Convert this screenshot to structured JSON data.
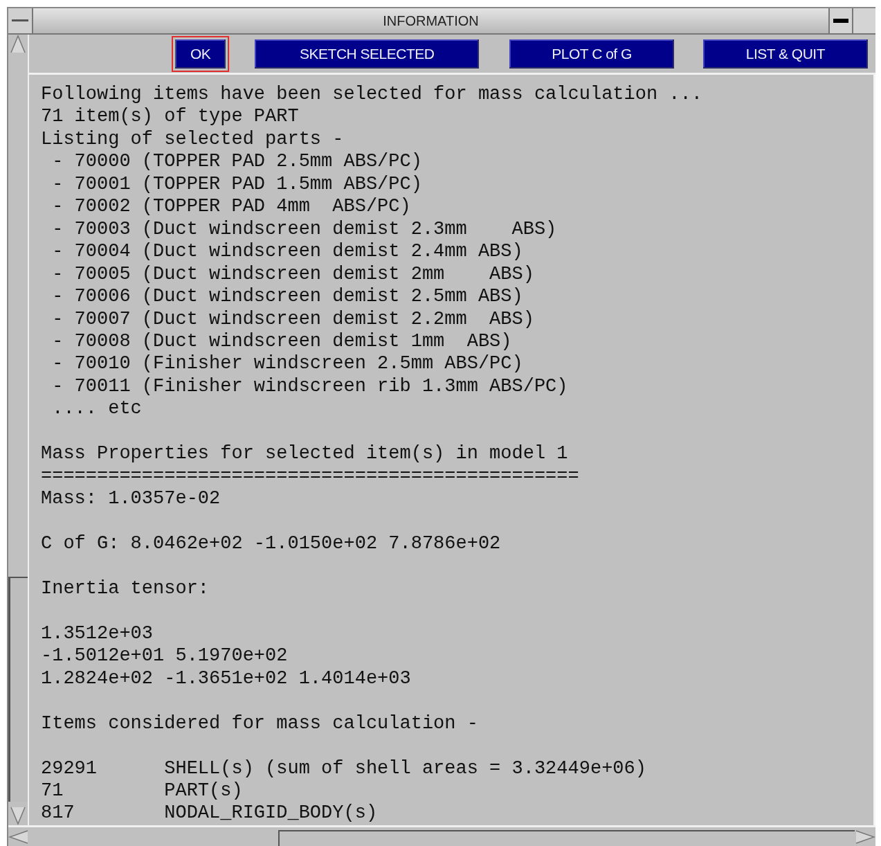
{
  "window": {
    "title": "INFORMATION"
  },
  "buttons": [
    {
      "label": "OK",
      "focused": true
    },
    {
      "label": "SKETCH SELECTED",
      "focused": false
    },
    {
      "label": "PLOT C of G",
      "focused": false
    },
    {
      "label": "LIST & QUIT",
      "focused": false
    }
  ],
  "sections": [
    {
      "lines": [
        "Following items have been selected for mass calculation ...",
        "71 item(s) of type PART",
        "Listing of selected parts -",
        " - 70000 (TOPPER PAD 2.5mm ABS/PC)",
        " - 70001 (TOPPER PAD 1.5mm ABS/PC)",
        " - 70002 (TOPPER PAD 4mm  ABS/PC)",
        " - 70003 (Duct windscreen demist 2.3mm    ABS)",
        " - 70004 (Duct windscreen demist 2.4mm ABS)",
        " - 70005 (Duct windscreen demist 2mm    ABS)",
        " - 70006 (Duct windscreen demist 2.5mm ABS)",
        " - 70007 (Duct windscreen demist 2.2mm  ABS)",
        " - 70008 (Duct windscreen demist 1mm  ABS)",
        " - 70010 (Finisher windscreen 2.5mm ABS/PC)",
        " - 70011 (Finisher windscreen rib 1.3mm ABS/PC)",
        " .... etc"
      ]
    },
    {
      "lines": [
        "Mass Properties for selected item(s) in model 1",
        "================================================",
        "Mass: 1.0357e-02"
      ]
    },
    {
      "lines": [
        "C of G: 8.0462e+02 -1.0150e+02 7.8786e+02"
      ]
    },
    {
      "lines": [
        "Inertia tensor:"
      ]
    },
    {
      "lines": [
        "1.3512e+03",
        "-1.5012e+01 5.1970e+02",
        "1.2824e+02 -1.3651e+02 1.4014e+03"
      ]
    },
    {
      "lines": [
        "Items considered for mass calculation -"
      ]
    },
    {
      "lines": [
        "29291      SHELL(s) (sum of shell areas = 3.32449e+06)",
        "71         PART(s)",
        "817        NODAL_RIGID_BODY(s)"
      ]
    }
  ]
}
